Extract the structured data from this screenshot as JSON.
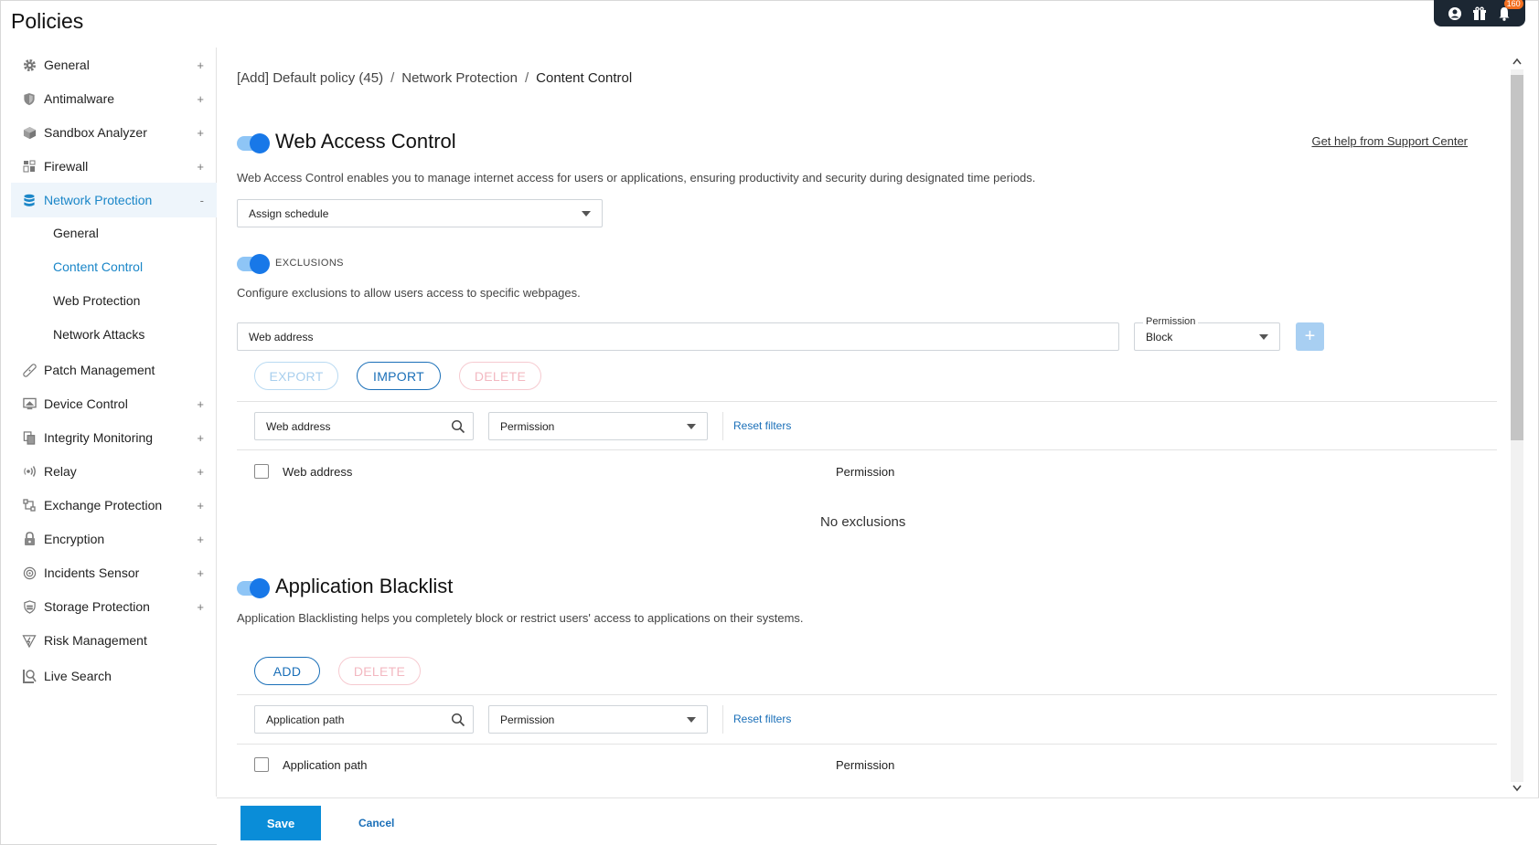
{
  "page": {
    "title": "Policies"
  },
  "topbar": {
    "notification_count": "160"
  },
  "sidebar": {
    "items": [
      {
        "label": "General",
        "icon": "gear-icon",
        "expand": "+"
      },
      {
        "label": "Antimalware",
        "icon": "shield-icon",
        "expand": "+"
      },
      {
        "label": "Sandbox Analyzer",
        "icon": "cube-icon",
        "expand": "+"
      },
      {
        "label": "Firewall",
        "icon": "firewall-icon",
        "expand": "+"
      },
      {
        "label": "Network Protection",
        "icon": "database-icon",
        "expand": "-"
      },
      {
        "label": "Patch Management",
        "icon": "bandage-icon",
        "expand": ""
      },
      {
        "label": "Device Control",
        "icon": "device-icon",
        "expand": "+"
      },
      {
        "label": "Integrity Monitoring",
        "icon": "documents-icon",
        "expand": "+"
      },
      {
        "label": "Relay",
        "icon": "relay-icon",
        "expand": "+"
      },
      {
        "label": "Exchange Protection",
        "icon": "exchange-icon",
        "expand": "+"
      },
      {
        "label": "Encryption",
        "icon": "lock-icon",
        "expand": "+"
      },
      {
        "label": "Incidents Sensor",
        "icon": "sensor-icon",
        "expand": "+"
      },
      {
        "label": "Storage Protection",
        "icon": "storage-icon",
        "expand": "+"
      },
      {
        "label": "Risk Management",
        "icon": "risk-icon",
        "expand": ""
      },
      {
        "label": "Live Search",
        "icon": "live-search-icon",
        "expand": ""
      }
    ],
    "subitems": [
      {
        "label": "General"
      },
      {
        "label": "Content Control"
      },
      {
        "label": "Web Protection"
      },
      {
        "label": "Network Attacks"
      }
    ]
  },
  "breadcrumb": {
    "items": [
      "[Add] Default policy (45)",
      "Network Protection",
      "Content Control"
    ],
    "separator": "/"
  },
  "web_access": {
    "title": "Web Access Control",
    "help_link": "Get help from Support Center",
    "description": "Web Access Control enables you to manage internet access for users or applications, ensuring productivity and security during designated time periods.",
    "schedule_select": "Assign schedule",
    "exclusions_label": "EXCLUSIONS",
    "exclusions_description": "Configure exclusions to allow users access to specific webpages.",
    "web_address_placeholder": "Web address",
    "permission_label": "Permission",
    "permission_value": "Block",
    "add_symbol": "+",
    "export_label": "EXPORT",
    "import_label": "IMPORT",
    "delete_label": "DELETE",
    "filter_search_placeholder": "Web address",
    "filter_permission": "Permission",
    "reset_filters": "Reset filters",
    "columns": [
      "Web address",
      "Permission"
    ],
    "empty_text": "No exclusions"
  },
  "app_blacklist": {
    "title": "Application Blacklist",
    "description": "Application Blacklisting helps you completely block or restrict users' access to applications on their systems.",
    "add_label": "ADD",
    "delete_label": "DELETE",
    "filter_search_placeholder": "Application path",
    "filter_permission": "Permission",
    "reset_filters": "Reset filters",
    "columns": [
      "Application path",
      "Permission"
    ]
  },
  "footer": {
    "save_label": "Save",
    "cancel_label": "Cancel"
  },
  "colors": {
    "accent": "#1a86c8",
    "primary_button": "#0a8dd8",
    "toggle_on": "#1878e8",
    "badge": "#f37021"
  }
}
